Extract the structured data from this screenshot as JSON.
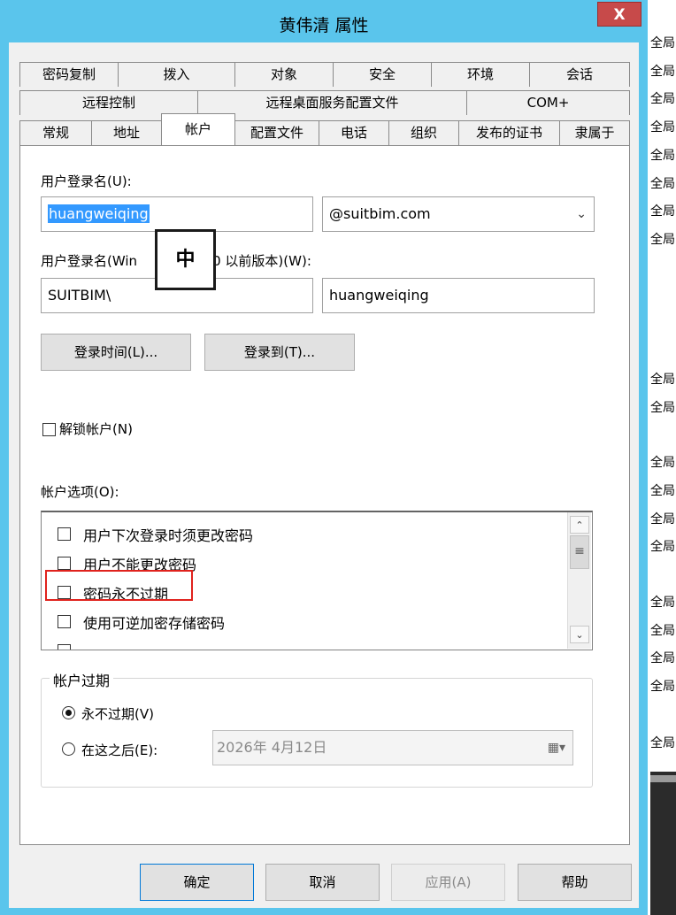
{
  "window": {
    "title": "黄伟清 属性",
    "close_glyph": "X"
  },
  "tabs": {
    "row1": [
      "密码复制",
      "拨入",
      "对象",
      "安全",
      "环境",
      "会话"
    ],
    "row2": [
      "远程控制",
      "远程桌面服务配置文件",
      "COM+"
    ],
    "row3": [
      "常规",
      "地址",
      "帐户",
      "配置文件",
      "电话",
      "组织",
      "发布的证书",
      "隶属于"
    ],
    "active": "帐户"
  },
  "account": {
    "logon_name_label": "用户登录名(U):",
    "logon_name_value": "huangweiqing",
    "domain_suffix": "@suitbim.com",
    "pre2000_label_left": "用户登录名(Win",
    "pre2000_label_right": "000 以前版本)(W):",
    "pre2000_domain": "SUITBIM\\",
    "pre2000_name": "huangweiqing",
    "logon_hours_button": "登录时间(L)...",
    "logon_to_button": "登录到(T)...",
    "unlock_label": "解锁帐户(N)",
    "options_label": "帐户选项(O):",
    "options": [
      "用户下次登录时须更改密码",
      "用户不能更改密码",
      "密码永不过期",
      "使用可逆加密存储密码"
    ]
  },
  "expiry": {
    "legend": "帐户过期",
    "never_label": "永不过期(V)",
    "after_label": "在这之后(E):",
    "date_value": "2026年  4月12日",
    "selected": "never"
  },
  "buttons": {
    "ok": "确定",
    "cancel": "取消",
    "apply": "应用(A)",
    "help": "帮助"
  },
  "ime": {
    "mode": "中"
  },
  "background_labels": [
    "全局",
    "全局",
    "全局",
    "全局",
    "全局",
    "全局",
    "全局",
    "全局",
    "全局",
    "全局",
    "全局",
    "全局",
    "全局",
    "全局",
    "全局",
    "全局",
    "全局",
    "全局",
    "全局"
  ],
  "colors": {
    "frame": "#5ac5ec",
    "close": "#c74a4a",
    "highlight": "#e0221d",
    "selection": "#3399ff"
  }
}
